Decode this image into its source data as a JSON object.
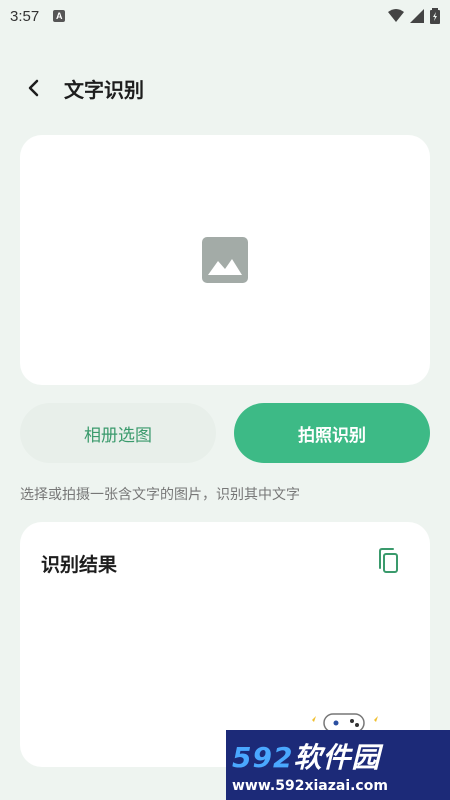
{
  "status": {
    "time": "3:57",
    "notif_letter": "A"
  },
  "header": {
    "title": "文字识别"
  },
  "image_picker": {
    "placeholder_icon": "image-icon"
  },
  "actions": {
    "album_label": "相册选图",
    "camera_label": "拍照识别"
  },
  "hint": "选择或拍摄一张含文字的图片，识别其中文字",
  "result": {
    "title": "识别结果",
    "copy_icon": "copy-icon"
  },
  "watermark": {
    "num": "592",
    "cn": "软件园",
    "url": "www.592xiazai.com"
  },
  "colors": {
    "accent": "#3dba86",
    "background": "#eef4f0",
    "card": "#ffffff"
  }
}
